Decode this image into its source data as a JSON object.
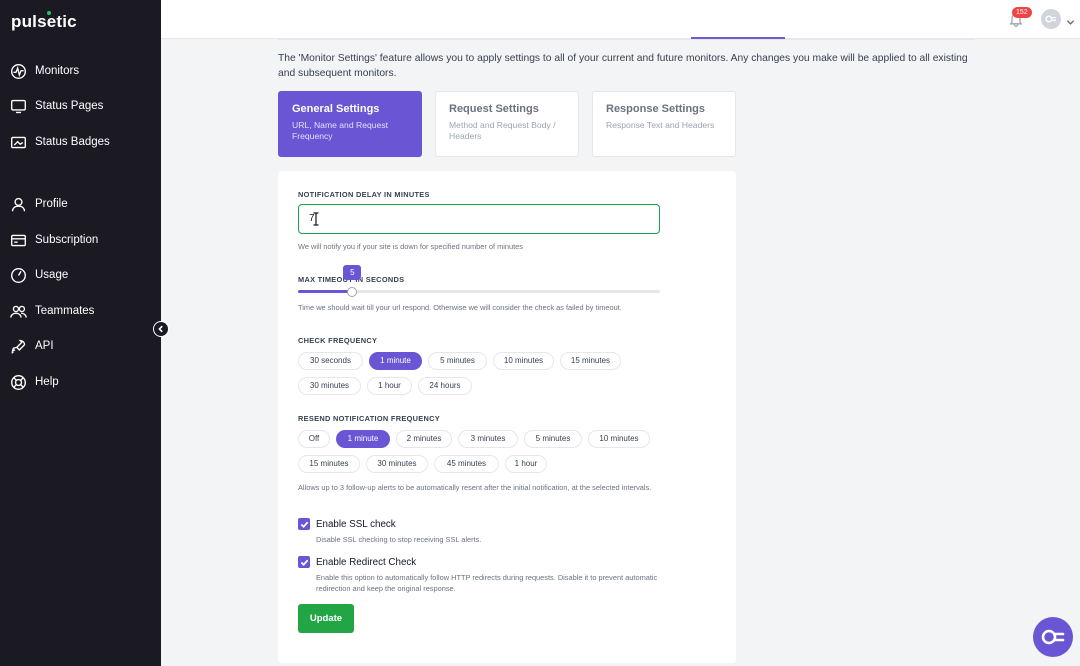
{
  "app": {
    "logo": "pulsetic"
  },
  "sidebar": {
    "items": [
      {
        "label": "Monitors",
        "icon": "monitor-pulse-icon"
      },
      {
        "label": "Status Pages",
        "icon": "desktop-icon"
      },
      {
        "label": "Status Badges",
        "icon": "badge-image-icon"
      },
      {
        "label": "Profile",
        "icon": "user-icon"
      },
      {
        "label": "Subscription",
        "icon": "credit-card-icon"
      },
      {
        "label": "Usage",
        "icon": "gauge-icon"
      },
      {
        "label": "Teammates",
        "icon": "users-icon"
      },
      {
        "label": "API",
        "icon": "rocket-icon"
      },
      {
        "label": "Help",
        "icon": "lifebuoy-icon"
      }
    ]
  },
  "topbar": {
    "notification_count": "152"
  },
  "intro_text": "The 'Monitor Settings' feature allows you to apply settings to all of your current and future monitors. Any changes you make will be applied to all existing and subsequent monitors.",
  "cards": [
    {
      "title": "General Settings",
      "desc": "URL, Name and Request Frequency",
      "active": true
    },
    {
      "title": "Request Settings",
      "desc": "Method and Request Body / Headers",
      "active": false
    },
    {
      "title": "Response Settings",
      "desc": "Response Text and Headers",
      "active": false
    }
  ],
  "notification_delay": {
    "label": "NOTIFICATION DELAY IN MINUTES",
    "value": "7",
    "help": "We will notify you if your site is down for specified number of minutes"
  },
  "max_timeout": {
    "label": "MAX TIMEOUT IN SECONDS",
    "value": "5",
    "fraction": 0.15,
    "help": "Time we should wait till your url respond. Otherwise we will consider the check as failed by timeout."
  },
  "check_frequency": {
    "label": "CHECK FREQUENCY",
    "options": [
      "30 seconds",
      "1 minute",
      "5 minutes",
      "10 minutes",
      "15 minutes",
      "30 minutes",
      "1 hour",
      "24 hours"
    ],
    "selected": "1 minute"
  },
  "resend_frequency": {
    "label": "RESEND NOTIFICATION FREQUENCY",
    "options": [
      "Off",
      "1 minute",
      "2 minutes",
      "3 minutes",
      "5 minutes",
      "10 minutes",
      "15 minutes",
      "30 minutes",
      "45 minutes",
      "1 hour"
    ],
    "selected": "1 minute",
    "help": "Allows up to 3 follow-up alerts to be automatically resent after the initial notification, at the selected intervals."
  },
  "ssl_check": {
    "label": "Enable SSL check",
    "help": "Disable SSL checking to stop receiving SSL alerts.",
    "checked": true
  },
  "redirect_check": {
    "label": "Enable Redirect Check",
    "help": "Enable this option to automatically follow HTTP redirects during requests. Disable it to prevent automatic redirection and keep the original response.",
    "checked": true
  },
  "update_button": "Update",
  "colors": {
    "accent": "#6a55d4",
    "sidebar": "#1b1a23",
    "success": "#22a645",
    "badge": "#ef4444"
  }
}
